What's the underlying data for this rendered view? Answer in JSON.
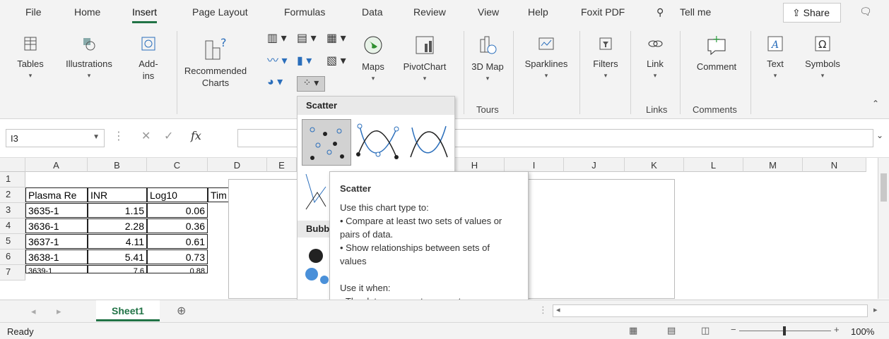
{
  "menu": {
    "tabs": [
      "File",
      "Home",
      "Insert",
      "Page Layout",
      "Formulas",
      "Data",
      "Review",
      "View",
      "Help",
      "Foxit PDF"
    ],
    "tell_me": "Tell me",
    "share": "Share"
  },
  "ribbon": {
    "tables": "Tables",
    "illustrations": "Illustrations",
    "addins": "Add-ins",
    "recommended_charts": "Recommended Charts",
    "maps": "Maps",
    "pivotchart": "PivotChart",
    "map3d": "3D Map",
    "sparklines": "Sparklines",
    "filters": "Filters",
    "link": "Link",
    "comment": "Comment",
    "text": "Text",
    "symbols": "Symbols",
    "group_tours": "Tours",
    "group_links": "Links",
    "group_comments": "Comments"
  },
  "formula_bar": {
    "name_box": "I3",
    "fx": "fx"
  },
  "columns": [
    "A",
    "B",
    "C",
    "D",
    "E",
    "",
    "H",
    "I",
    "J",
    "K",
    "L",
    "M",
    "N"
  ],
  "rows": [
    "1",
    "2",
    "3",
    "4",
    "5",
    "6",
    "7"
  ],
  "cells": {
    "r2": [
      "Plasma Re",
      "INR",
      "Log10",
      "Tim"
    ],
    "r3": [
      "3635-1",
      "1.15",
      "0.06"
    ],
    "r4": [
      "3636-1",
      "2.28",
      "0.36"
    ],
    "r5": [
      "3637-1",
      "4.11",
      "0.61"
    ],
    "r6": [
      "3638-1",
      "5.41",
      "0.73"
    ],
    "r7": [
      "3639-1",
      "7.6",
      "0.88"
    ]
  },
  "dropdown": {
    "header": "Scatter",
    "bubble": "Bubbl"
  },
  "tooltip": {
    "title": "Scatter",
    "line1": "Use this chart type to:",
    "line2": "• Compare at least two sets of values or pairs of data.",
    "line3": "• Show relationships between sets of values",
    "line4": "Use it when:",
    "line5": "• The data represents separate measurements."
  },
  "sheet": {
    "name": "Sheet1"
  },
  "status": {
    "ready": "Ready",
    "zoom": "100%"
  }
}
